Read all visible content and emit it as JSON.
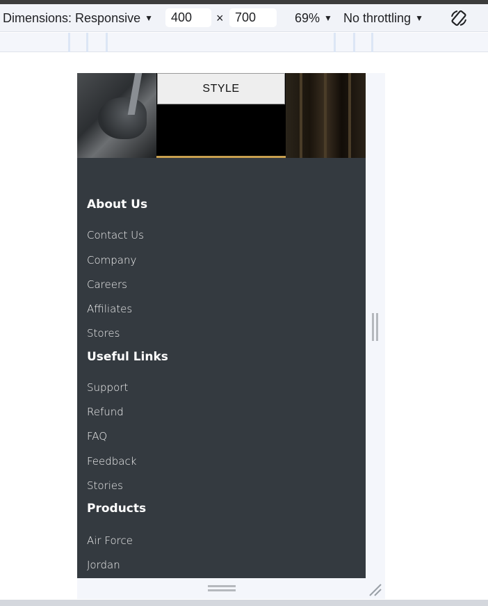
{
  "toolbar": {
    "dimensions_label": "Dimensions: Responsive",
    "width_value": "400",
    "times_symbol": "×",
    "height_value": "700",
    "zoom_label": "69%",
    "throttling_label": "No throttling",
    "caret": "▼"
  },
  "icons": {
    "rotate": "rotate-icon",
    "dropdown": "caret-down-icon"
  },
  "page": {
    "hero_button": "STYLE",
    "sections": [
      {
        "title": "About Us",
        "links": [
          "Contact Us",
          "Company",
          "Careers",
          "Affiliates",
          "Stores"
        ]
      },
      {
        "title": "Useful Links",
        "links": [
          "Support",
          "Refund",
          "FAQ",
          "Feedback",
          "Stories"
        ]
      },
      {
        "title": "Products",
        "links": [
          "Air Force",
          "Jordan"
        ]
      }
    ]
  },
  "colors": {
    "footer_bg": "#343a40",
    "accent_line": "#c9a04f",
    "toolbar_bg": "#f1f3f8"
  }
}
